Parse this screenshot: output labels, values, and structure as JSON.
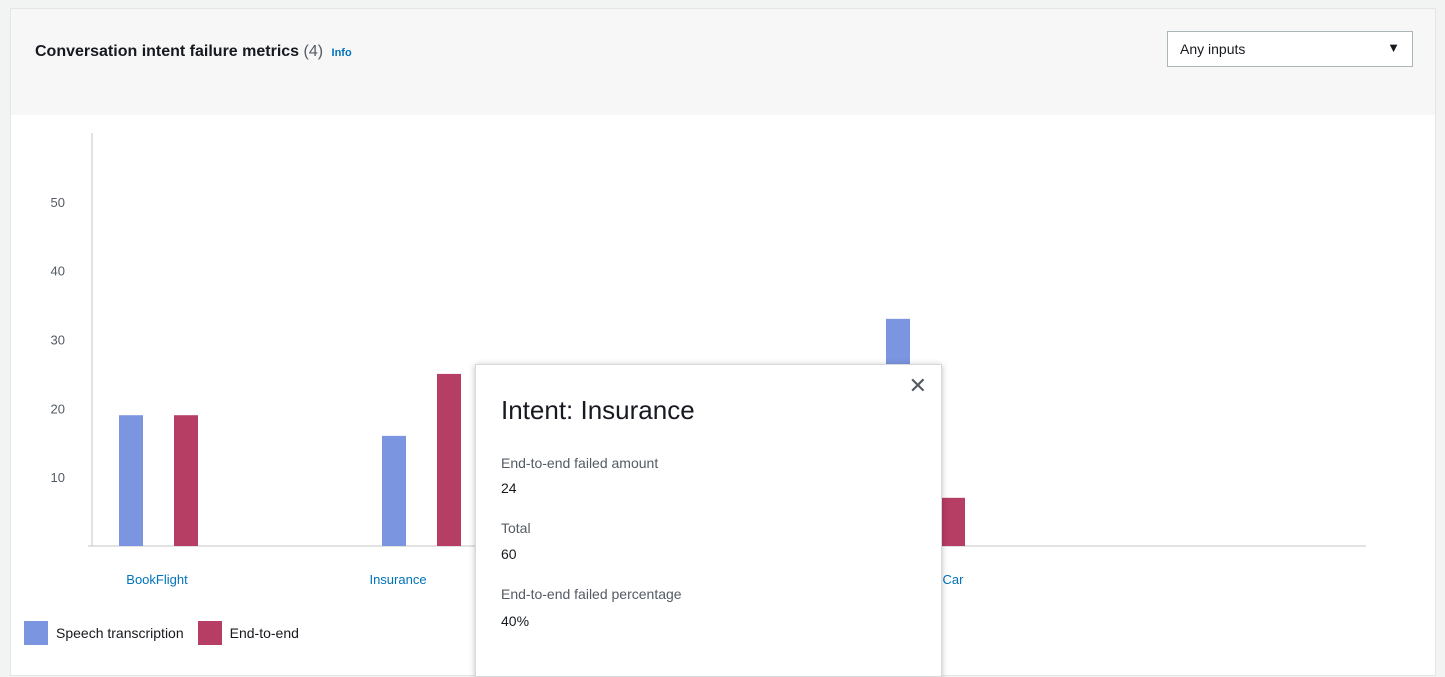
{
  "header": {
    "title": "Conversation intent failure metrics",
    "count": "(4)",
    "info_link": "Info"
  },
  "input_filter": {
    "selected": "Any inputs",
    "caret_icon": "caret-down-icon"
  },
  "chart_data": {
    "type": "bar",
    "categories": [
      "BookFlight",
      "Insurance",
      "",
      "Car"
    ],
    "series": [
      {
        "name": "Speech transcription",
        "color": "#7b95e0",
        "values": [
          19,
          16,
          null,
          33
        ]
      },
      {
        "name": "End-to-end",
        "color": "#b63d63",
        "values": [
          19,
          25,
          null,
          7
        ]
      }
    ],
    "yticks": [
      10,
      20,
      30,
      40,
      50
    ],
    "ylim": [
      0,
      60
    ],
    "grid": false,
    "legend_position": "bottom-left"
  },
  "legend": {
    "speech": "Speech transcription",
    "end_to_end": "End-to-end"
  },
  "popover": {
    "title": "Intent: Insurance",
    "close_icon": "close-icon",
    "fields": [
      {
        "label": "End-to-end failed amount",
        "value": "24"
      },
      {
        "label": "Total",
        "value": "60"
      },
      {
        "label": "End-to-end failed percentage",
        "value": "40%"
      }
    ]
  }
}
